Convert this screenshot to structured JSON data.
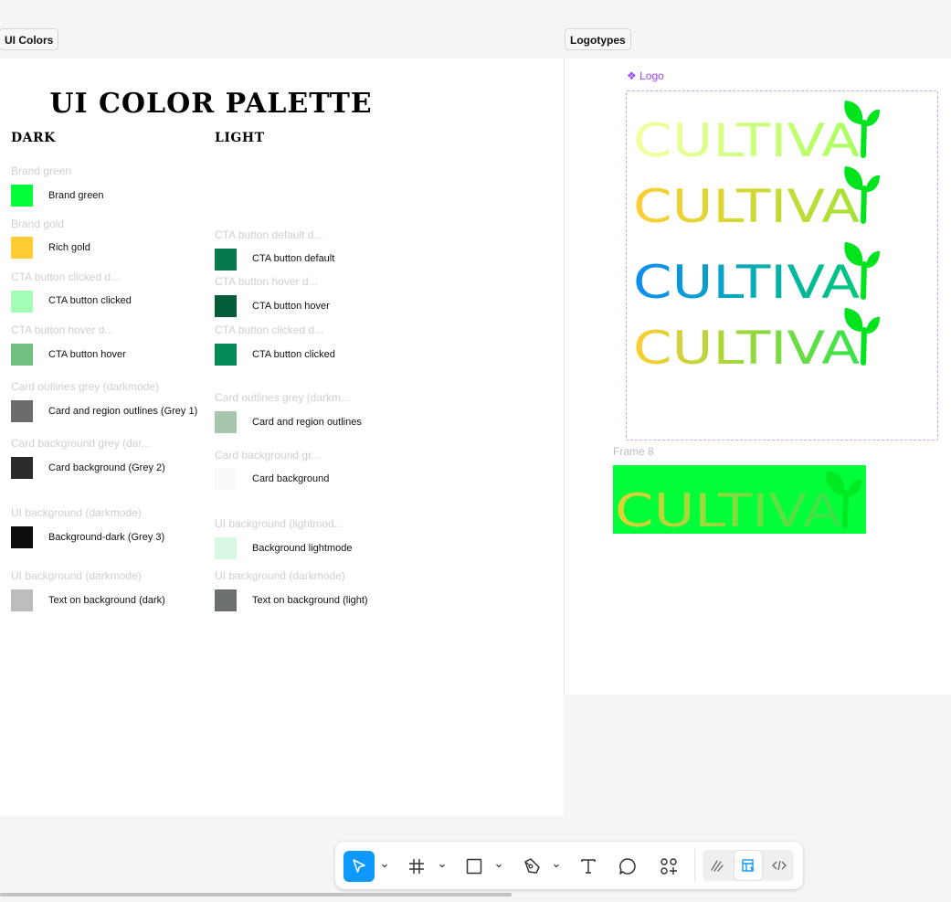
{
  "frames": {
    "colors_label": "UI Colors",
    "logos_label": "Logotypes"
  },
  "palette": {
    "title": "UI COLOR PALETTE",
    "dark_heading": "DARK",
    "light_heading": "LIGHT",
    "dark": [
      {
        "group": "Brand green",
        "label": "Brand green",
        "color": "#00ff38"
      },
      {
        "group": "Brand gold",
        "label": "Rich gold",
        "color": "#ffcd33"
      },
      {
        "group": "CTA button clicked d...",
        "label": "CTA button clicked",
        "color": "#a3ffb6"
      },
      {
        "group": "CTA button hover d...",
        "label": "CTA button hover",
        "color": "#71bf82"
      },
      {
        "group": "Card outlines grey (darkmode)",
        "label": "Card and region outlines (Grey 1)",
        "color": "#6b6b6b"
      },
      {
        "group": "Card background grey (dar...",
        "label": "Card background (Grey 2)",
        "color": "#2b2b2b"
      },
      {
        "group": "UI background (darkmode)",
        "label": "Background-dark (Grey 3)",
        "color": "#0e0e0e"
      },
      {
        "group": "UI background (darkmode)",
        "label": "Text on background (dark)",
        "color": "#bdbdbd"
      }
    ],
    "light": [
      {
        "group": "CTA button default d...",
        "label": "CTA button default",
        "color": "#067a4f"
      },
      {
        "group": "CTA button hover d...",
        "label": "CTA button hover",
        "color": "#035d38"
      },
      {
        "group": "CTA button clicked d...",
        "label": "CTA button clicked",
        "color": "#048a58"
      },
      {
        "group": "Card outlines grey (darkm...",
        "label": "Card and region outlines",
        "color": "#a8c6ae"
      },
      {
        "group": "Card background gr...",
        "label": "Card background",
        "color": "#f8faf8"
      },
      {
        "group": "UI background (lightmod...",
        "label": "Background lightmode",
        "color": "#d8f8e4"
      },
      {
        "group": "UI background (darkmode)",
        "label": "Text on background (light)",
        "color": "#6b706c"
      }
    ]
  },
  "logotypes": {
    "component_label": "❖ Logo",
    "frame8_label": "Frame 8",
    "wordmark": "CULTIVA",
    "leaf_color": "#00e31d",
    "frame8_bg": "#00ff38",
    "variants": [
      {
        "from": "#f6ffa0",
        "to": "#a8ff5e"
      },
      {
        "from": "#ffcd33",
        "to": "#a6e236"
      },
      {
        "from": "#0d8cf5",
        "to": "#00c77a"
      },
      {
        "from": "#ffcd33",
        "to": "#34e24a"
      }
    ]
  },
  "toolbar": {
    "tools": [
      "move-tool",
      "frame-tool",
      "rectangle-tool",
      "pen-tool",
      "text-tool",
      "comment-tool",
      "actions-tool"
    ],
    "accent": "#0d99ff",
    "modes": [
      "draw-mode",
      "design-mode",
      "dev-mode"
    ]
  }
}
